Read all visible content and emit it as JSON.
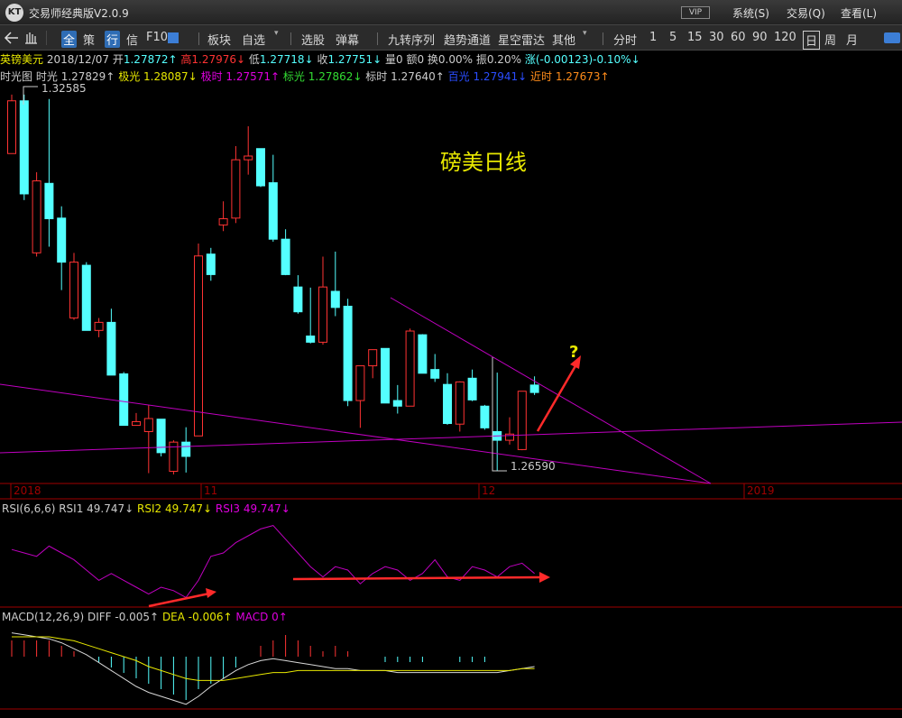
{
  "app": {
    "title": "交易师经典版V2.0.9",
    "logo_text": "KT",
    "vip": "VIP"
  },
  "title_menu": [
    "系统(S)",
    "交易(Q)",
    "查看(L)"
  ],
  "toolbar": {
    "items": [
      "全",
      "策",
      "行",
      "信",
      "F10",
      "板块",
      "自选",
      "选股",
      "弹幕",
      "九转序列",
      "趋势通道",
      "星空雷达",
      "其他",
      "分时",
      "1",
      "5",
      "15",
      "30",
      "60",
      "90",
      "120",
      "日",
      "周",
      "月"
    ]
  },
  "quote": {
    "name": "英镑美元",
    "date": "2018/12/07",
    "open_label": "开",
    "open": "1.27872↑",
    "high_label": "高",
    "high": "1.27976↓",
    "low_label": "低",
    "low": "1.27718↓",
    "close_label": "收",
    "close": "1.27751↓",
    "vol": "量0",
    "amount": "额0",
    "turnover": "换0.00%",
    "amplitude": "振0.20%",
    "change": "涨(-0.00123)-0.10%↓"
  },
  "stats": {
    "chart_label": "时光图",
    "s1_label": "时光",
    "s1": "1.27829↑",
    "s2_label": "极光",
    "s2": "1.28087↓",
    "s3_label": "极时",
    "s3": "1.27571↑",
    "s4_label": "标光",
    "s4": "1.27862↓",
    "s5_label": "标时",
    "s5": "1.27640↑",
    "s6_label": "百光",
    "s6": "1.27941↓",
    "s7_label": "近时",
    "s7": "1.27673↑"
  },
  "annotations": {
    "chart_title": "磅美日线",
    "question": "?",
    "high_mark": "1.32585",
    "low_mark": "1.26590"
  },
  "date_axis": [
    "2018",
    "11",
    "12",
    "2019"
  ],
  "rsi": {
    "label": "RSI(6,6,6)",
    "rsi1": "RSI1 49.747↓",
    "rsi2": "RSI2 49.747↓",
    "rsi3": "RSI3 49.747↓"
  },
  "macd": {
    "label": "MACD(12,26,9)",
    "diff": "DIFF -0.005↑",
    "dea": "DEA -0.006↑",
    "macd": "MACD 0↑"
  },
  "colors": {
    "up": "#ff3333",
    "down": "#54ffff",
    "trend": "#c000c0",
    "arrow": "#ff2a2a",
    "yellow": "#e8e800"
  },
  "chart_data": {
    "type": "candlestick",
    "title": "磅美日线",
    "candles": [
      {
        "o": 1.316,
        "h": 1.3255,
        "l": 1.3165,
        "c": 1.3245
      },
      {
        "o": 1.3245,
        "h": 1.3255,
        "l": 1.3085,
        "c": 1.3095
      },
      {
        "o": 1.3,
        "h": 1.313,
        "l": 1.2994,
        "c": 1.3116
      },
      {
        "o": 1.3112,
        "h": 1.3248,
        "l": 1.301,
        "c": 1.3055
      },
      {
        "o": 1.3056,
        "h": 1.3075,
        "l": 1.294,
        "c": 1.2985
      },
      {
        "o": 1.2895,
        "h": 1.3,
        "l": 1.2892,
        "c": 1.2985
      },
      {
        "o": 1.298,
        "h": 1.2985,
        "l": 1.2875,
        "c": 1.2875
      },
      {
        "o": 1.2875,
        "h": 1.2895,
        "l": 1.2864,
        "c": 1.2888
      },
      {
        "o": 1.2888,
        "h": 1.291,
        "l": 1.2805,
        "c": 1.2803
      },
      {
        "o": 1.2805,
        "h": 1.2808,
        "l": 1.2725,
        "c": 1.2722
      },
      {
        "o": 1.2722,
        "h": 1.2742,
        "l": 1.2726,
        "c": 1.2728
      },
      {
        "o": 1.2712,
        "h": 1.2755,
        "l": 1.2645,
        "c": 1.2733
      },
      {
        "o": 1.2732,
        "h": 1.2725,
        "l": 1.2672,
        "c": 1.2678
      },
      {
        "o": 1.2648,
        "h": 1.2698,
        "l": 1.2643,
        "c": 1.2695
      },
      {
        "o": 1.2695,
        "h": 1.2719,
        "l": 1.2646,
        "c": 1.2672
      },
      {
        "o": 1.2705,
        "h": 1.3015,
        "l": 1.2728,
        "c": 1.2995
      },
      {
        "o": 1.2998,
        "h": 1.3008,
        "l": 1.2955,
        "c": 1.2965
      },
      {
        "o": 1.3045,
        "h": 1.3083,
        "l": 1.3035,
        "c": 1.3055
      },
      {
        "o": 1.3056,
        "h": 1.3172,
        "l": 1.3048,
        "c": 1.315
      },
      {
        "o": 1.315,
        "h": 1.3204,
        "l": 1.3126,
        "c": 1.3156
      },
      {
        "o": 1.3168,
        "h": 1.3147,
        "l": 1.3106,
        "c": 1.3108
      },
      {
        "o": 1.3113,
        "h": 1.3158,
        "l": 1.3018,
        "c": 1.3022
      },
      {
        "o": 1.3022,
        "h": 1.3038,
        "l": 1.2964,
        "c": 1.2965
      },
      {
        "o": 1.2945,
        "h": 1.2964,
        "l": 1.2902,
        "c": 1.2905
      },
      {
        "o": 1.2866,
        "h": 1.2944,
        "l": 1.2854,
        "c": 1.2856
      },
      {
        "o": 1.2856,
        "h": 1.2994,
        "l": 1.2852,
        "c": 1.2945
      },
      {
        "o": 1.2938,
        "h": 1.3002,
        "l": 1.2898,
        "c": 1.2912
      },
      {
        "o": 1.2914,
        "h": 1.2926,
        "l": 1.2753,
        "c": 1.2762
      },
      {
        "o": 1.2762,
        "h": 1.281,
        "l": 1.2718,
        "c": 1.2818
      },
      {
        "o": 1.2818,
        "h": 1.2832,
        "l": 1.2798,
        "c": 1.2844
      },
      {
        "o": 1.2846,
        "h": 1.2845,
        "l": 1.2765,
        "c": 1.2758
      },
      {
        "o": 1.2762,
        "h": 1.2787,
        "l": 1.2741,
        "c": 1.2753
      },
      {
        "o": 1.2753,
        "h": 1.2878,
        "l": 1.2762,
        "c": 1.2874
      },
      {
        "o": 1.2868,
        "h": 1.2869,
        "l": 1.2806,
        "c": 1.2806
      },
      {
        "o": 1.2812,
        "h": 1.2837,
        "l": 1.2792,
        "c": 1.2798
      },
      {
        "o": 1.2788,
        "h": 1.2806,
        "l": 1.2723,
        "c": 1.2725
      },
      {
        "o": 1.2724,
        "h": 1.2793,
        "l": 1.2712,
        "c": 1.2792
      },
      {
        "o": 1.2798,
        "h": 1.2812,
        "l": 1.2761,
        "c": 1.2763
      },
      {
        "o": 1.2753,
        "h": 1.2755,
        "l": 1.2715,
        "c": 1.2718
      },
      {
        "o": 1.2712,
        "h": 1.2807,
        "l": 1.2648,
        "c": 1.2698
      },
      {
        "o": 1.2698,
        "h": 1.2735,
        "l": 1.2691,
        "c": 1.2708
      },
      {
        "o": 1.2683,
        "h": 1.2775,
        "l": 1.2682,
        "c": 1.2777
      },
      {
        "o": 1.2787,
        "h": 1.2801,
        "l": 1.2771,
        "c": 1.2775
      }
    ],
    "rsi": [
      62,
      60,
      58,
      64,
      60,
      56,
      50,
      44,
      48,
      44,
      40,
      36,
      40,
      38,
      34,
      44,
      58,
      60,
      66,
      70,
      74,
      76,
      68,
      60,
      52,
      46,
      52,
      50,
      42,
      48,
      52,
      50,
      44,
      48,
      56,
      46,
      44,
      52,
      50,
      46,
      52,
      54,
      48
    ],
    "macd_hist": [
      0.003,
      0.003,
      0.003,
      0.003,
      0.002,
      0.001,
      0,
      -0.001,
      -0.002,
      -0.003,
      -0.004,
      -0.005,
      -0.006,
      -0.007,
      -0.008,
      -0.006,
      -0.005,
      -0.004,
      -0.002,
      0,
      0.002,
      0.003,
      0.004,
      0.003,
      0.002,
      0.001,
      0.002,
      0.001,
      0,
      0,
      -0.001,
      -0.001,
      -0.001,
      -0.001,
      0,
      0,
      -0.001,
      -0.001,
      -0.001,
      0,
      0,
      0,
      0
    ],
    "diff": [
      0.012,
      0.011,
      0.01,
      0.009,
      0.007,
      0.004,
      0.001,
      -0.003,
      -0.007,
      -0.011,
      -0.015,
      -0.018,
      -0.02,
      -0.022,
      -0.024,
      -0.02,
      -0.015,
      -0.011,
      -0.007,
      -0.004,
      -0.002,
      -0.001,
      -0.002,
      -0.003,
      -0.004,
      -0.005,
      -0.006,
      -0.006,
      -0.007,
      -0.007,
      -0.007,
      -0.008,
      -0.008,
      -0.008,
      -0.008,
      -0.008,
      -0.008,
      -0.008,
      -0.008,
      -0.008,
      -0.007,
      -0.006,
      -0.005
    ],
    "dea": [
      0.01,
      0.01,
      0.01,
      0.01,
      0.009,
      0.008,
      0.006,
      0.004,
      0.002,
      0,
      -0.002,
      -0.005,
      -0.007,
      -0.009,
      -0.011,
      -0.012,
      -0.012,
      -0.012,
      -0.011,
      -0.01,
      -0.009,
      -0.008,
      -0.008,
      -0.007,
      -0.007,
      -0.007,
      -0.007,
      -0.007,
      -0.007,
      -0.007,
      -0.007,
      -0.007,
      -0.007,
      -0.007,
      -0.007,
      -0.007,
      -0.007,
      -0.007,
      -0.007,
      -0.007,
      -0.007,
      -0.006,
      -0.006
    ]
  }
}
